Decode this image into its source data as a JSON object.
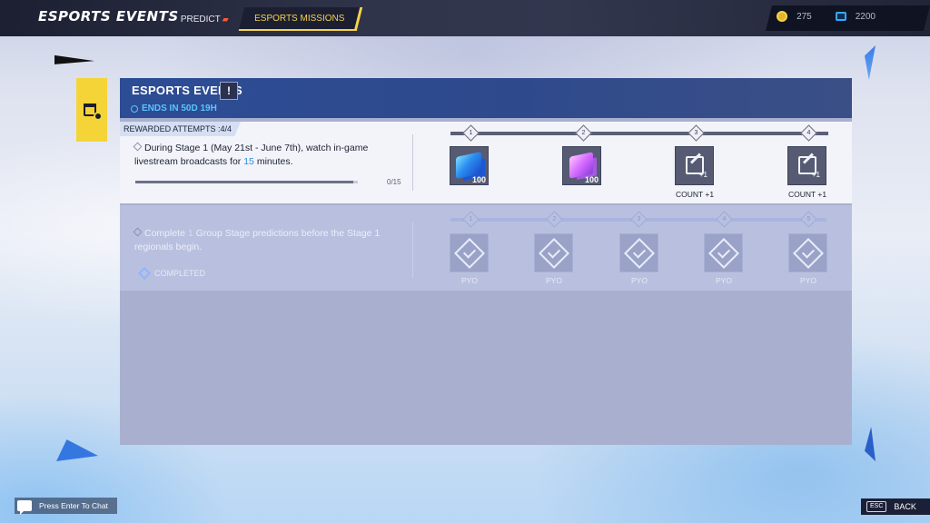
{
  "header": {
    "title": "ESPORTS EVENTS",
    "tabs": [
      {
        "label": "PREDICT",
        "active": false
      },
      {
        "label": "ESPORTS MISSIONS",
        "active": true
      }
    ],
    "currency": [
      {
        "icon": "gold-coin-icon",
        "value": "275"
      },
      {
        "icon": "blue-unit-icon",
        "value": "2200"
      }
    ]
  },
  "panel": {
    "title": "ESPORTS EVENTS",
    "info_label": "!",
    "ends_in": "ENDS IN 50D 19H"
  },
  "missions": [
    {
      "attempts": "REWARDED ATTEMPTS :4/4",
      "desc_before": "During Stage 1 (May 21st - June 7th), watch in-game livestream broadcasts for ",
      "desc_highlight": "15",
      "desc_after": " minutes.",
      "progress_text": "0/15",
      "progress_fraction": 0.0,
      "nodes": [
        "1",
        "2",
        "3",
        "4"
      ],
      "rewards": [
        {
          "icon": "blue-cube-icon",
          "qty": "100",
          "label": ""
        },
        {
          "icon": "pink-cube-icon",
          "qty": "100",
          "label": ""
        },
        {
          "icon": "edit-count-icon",
          "qty": "+1",
          "label": "COUNT +1"
        },
        {
          "icon": "edit-count-icon",
          "qty": "+1",
          "label": "COUNT +1"
        }
      ]
    },
    {
      "desc_before": "Complete ",
      "desc_highlight": "1",
      "desc_after": " Group Stage predictions before the Stage 1 regionals begin.",
      "status": "COMPLETED",
      "nodes": [
        "1",
        "2",
        "3",
        "4",
        "5"
      ],
      "rewards": [
        {
          "icon": "pyo-icon",
          "label": "PYO"
        },
        {
          "icon": "pyo-icon",
          "label": "PYO"
        },
        {
          "icon": "pyo-icon",
          "label": "PYO"
        },
        {
          "icon": "pyo-icon",
          "label": "PYO"
        },
        {
          "icon": "pyo-icon",
          "label": "PYO"
        }
      ]
    }
  ],
  "footer": {
    "chat": "Press Enter To Chat",
    "esc_key": "ESC",
    "back": "BACK"
  }
}
